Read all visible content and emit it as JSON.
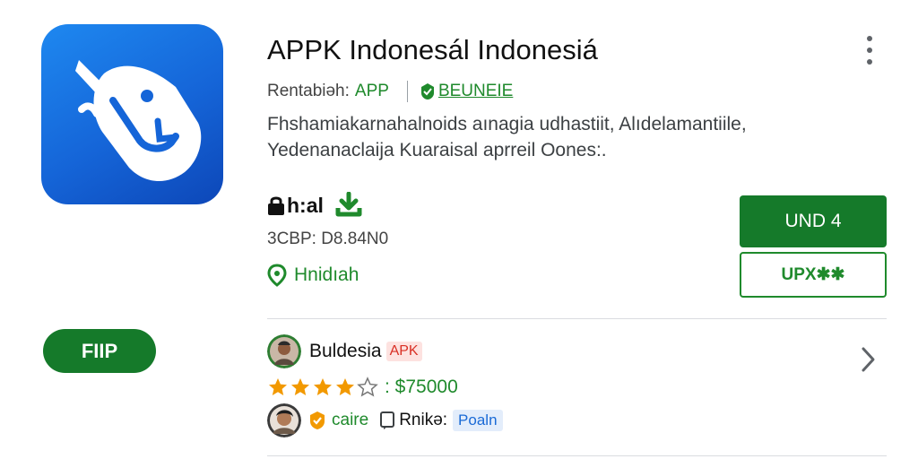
{
  "app": {
    "title": "APPK Indonesál Indonesiá",
    "rating_label": "Rentabiəh:",
    "category": "APP",
    "developer": "BEUNEIE",
    "description_lines": [
      "Fhshamiakarnahalnoids aınagia udhastiit, Alıdelamantiile,",
      "Yedenanaclaija Kuaraisal aprreil Oones:."
    ],
    "stat_label": "h:al",
    "size_text": "3CBP: D8.84N0",
    "location_label": "Hnidıah"
  },
  "buttons": {
    "primary_label": "UND 4",
    "secondary_label": "UPX✱✱"
  },
  "pill": {
    "label": "FIIP"
  },
  "review": {
    "reviewer_name": "Buldesia",
    "badge": "APK",
    "rating": 4,
    "rating_max": 5,
    "price_text": ": $75000",
    "care_text": "caire",
    "rating_label": "Rnikə:",
    "tag": "Poaln"
  },
  "colors": {
    "brand_green": "#157a2a",
    "link_green": "#1f8a2c",
    "icon_blue": "#1565d8",
    "star_orange": "#f29900",
    "badge_red": "#d93025",
    "badge_blue": "#1a6ad6"
  },
  "icons": {
    "more": "more-vert-icon",
    "developer": "developer-badge-icon",
    "lock": "lock-icon",
    "download": "download-icon",
    "location": "location-pin-icon",
    "chevron": "chevron-right-icon",
    "star": "star-icon",
    "verified": "verified-badge-icon",
    "chat": "chat-icon"
  }
}
